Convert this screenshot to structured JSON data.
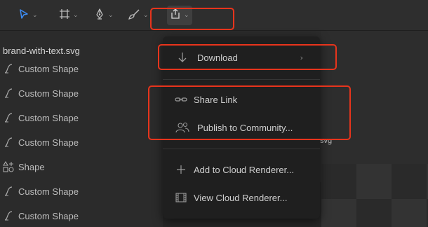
{
  "toolbar": {
    "tools": [
      {
        "icon": "pointer-icon",
        "has_menu": true
      },
      {
        "icon": "frame-icon",
        "has_menu": true
      },
      {
        "icon": "pen-icon",
        "has_menu": true
      },
      {
        "icon": "brush-icon",
        "has_menu": true
      },
      {
        "icon": "export-icon",
        "has_menu": true,
        "active": true
      }
    ],
    "chevron": "⌄"
  },
  "layers": {
    "file_name": "brand-with-text.svg",
    "items": [
      {
        "icon": "path-icon",
        "label": "Custom Shape"
      },
      {
        "icon": "path-icon",
        "label": "Custom Shape"
      },
      {
        "icon": "path-icon",
        "label": "Custom Shape"
      },
      {
        "icon": "path-icon",
        "label": "Custom Shape"
      },
      {
        "icon": "shapes-icon",
        "label": "Shape"
      },
      {
        "icon": "path-icon",
        "label": "Custom Shape"
      },
      {
        "icon": "path-icon",
        "label": "Custom Shape"
      }
    ]
  },
  "canvas": {
    "label": "svg"
  },
  "export_menu": {
    "download": {
      "label": "Download",
      "icon": "download-icon",
      "submenu_arrow": "›"
    },
    "share_link": {
      "label": "Share Link",
      "icon": "link-icon"
    },
    "publish": {
      "label": "Publish to Community...",
      "icon": "community-icon"
    },
    "add_cloud": {
      "label": "Add to Cloud Renderer...",
      "icon": "plus-icon"
    },
    "view_cloud": {
      "label": "View Cloud Renderer...",
      "icon": "film-icon"
    }
  },
  "colors": {
    "highlight": "#e8341c",
    "accent": "#3d8df5"
  }
}
